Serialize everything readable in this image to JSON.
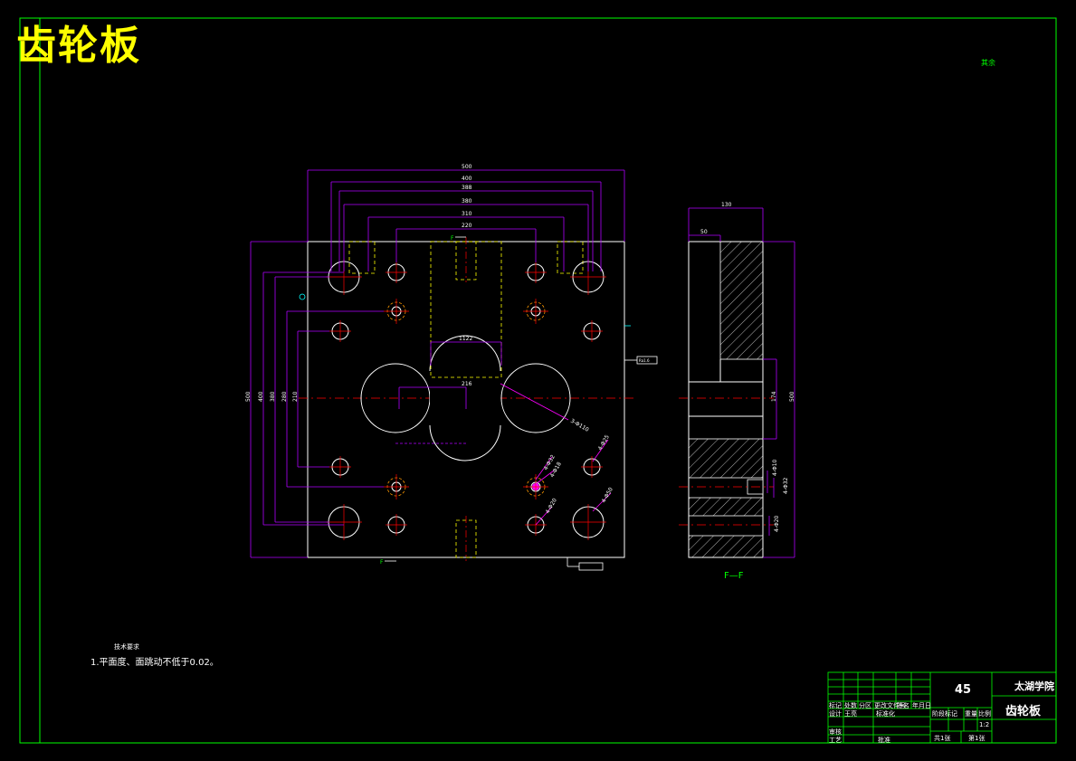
{
  "title": "齿轮板",
  "top_right_note": "其余",
  "section_label": "F—F",
  "section_marker": "F",
  "tech_notes": {
    "heading": "技术要求",
    "line1": "1.平面度、面跳动不低于0.02。"
  },
  "front_view_dims": {
    "top": [
      "500",
      "400",
      "388",
      "380",
      "310",
      "220"
    ],
    "left": [
      "500",
      "400",
      "380",
      "280",
      "210"
    ],
    "center_top": "1122",
    "center_mid": "216",
    "right_side": "Ra1.6"
  },
  "callouts": [
    "3-Φ110",
    "4-Φ25",
    "4-Φ32",
    "4-Φ18",
    "4-Φ20",
    "4-Φ50"
  ],
  "side_view_dims": {
    "top_total": "130",
    "top_step": "50",
    "right_total": "500",
    "right_mid": "174",
    "callouts": [
      "4-Φ10",
      "4-Φ32",
      "4-Φ20"
    ]
  },
  "title_block": {
    "material": "45",
    "school": "太湖学院",
    "part_name": "齿轮板",
    "row_labels": [
      "标记",
      "处数",
      "分区",
      "更改文件号",
      "签名",
      "年月日"
    ],
    "designer_label": "设计",
    "designer": "王亮",
    "standard_label": "标准化",
    "review_label": "审核",
    "process_label": "工艺",
    "approve_label": "批准",
    "stage_label": "阶段标记",
    "weight_label": "重量",
    "scale_label": "比例",
    "scale": "1:2",
    "sheets_label": "共1张",
    "sheet_label": "第1张"
  },
  "colors": {
    "border": "#00ff00",
    "outline": "#ffffff",
    "dimension": "#b000ff",
    "hidden": "#ffff00",
    "center": "#ff0000",
    "callout": "#ff00ff",
    "title": "#ffff00"
  }
}
